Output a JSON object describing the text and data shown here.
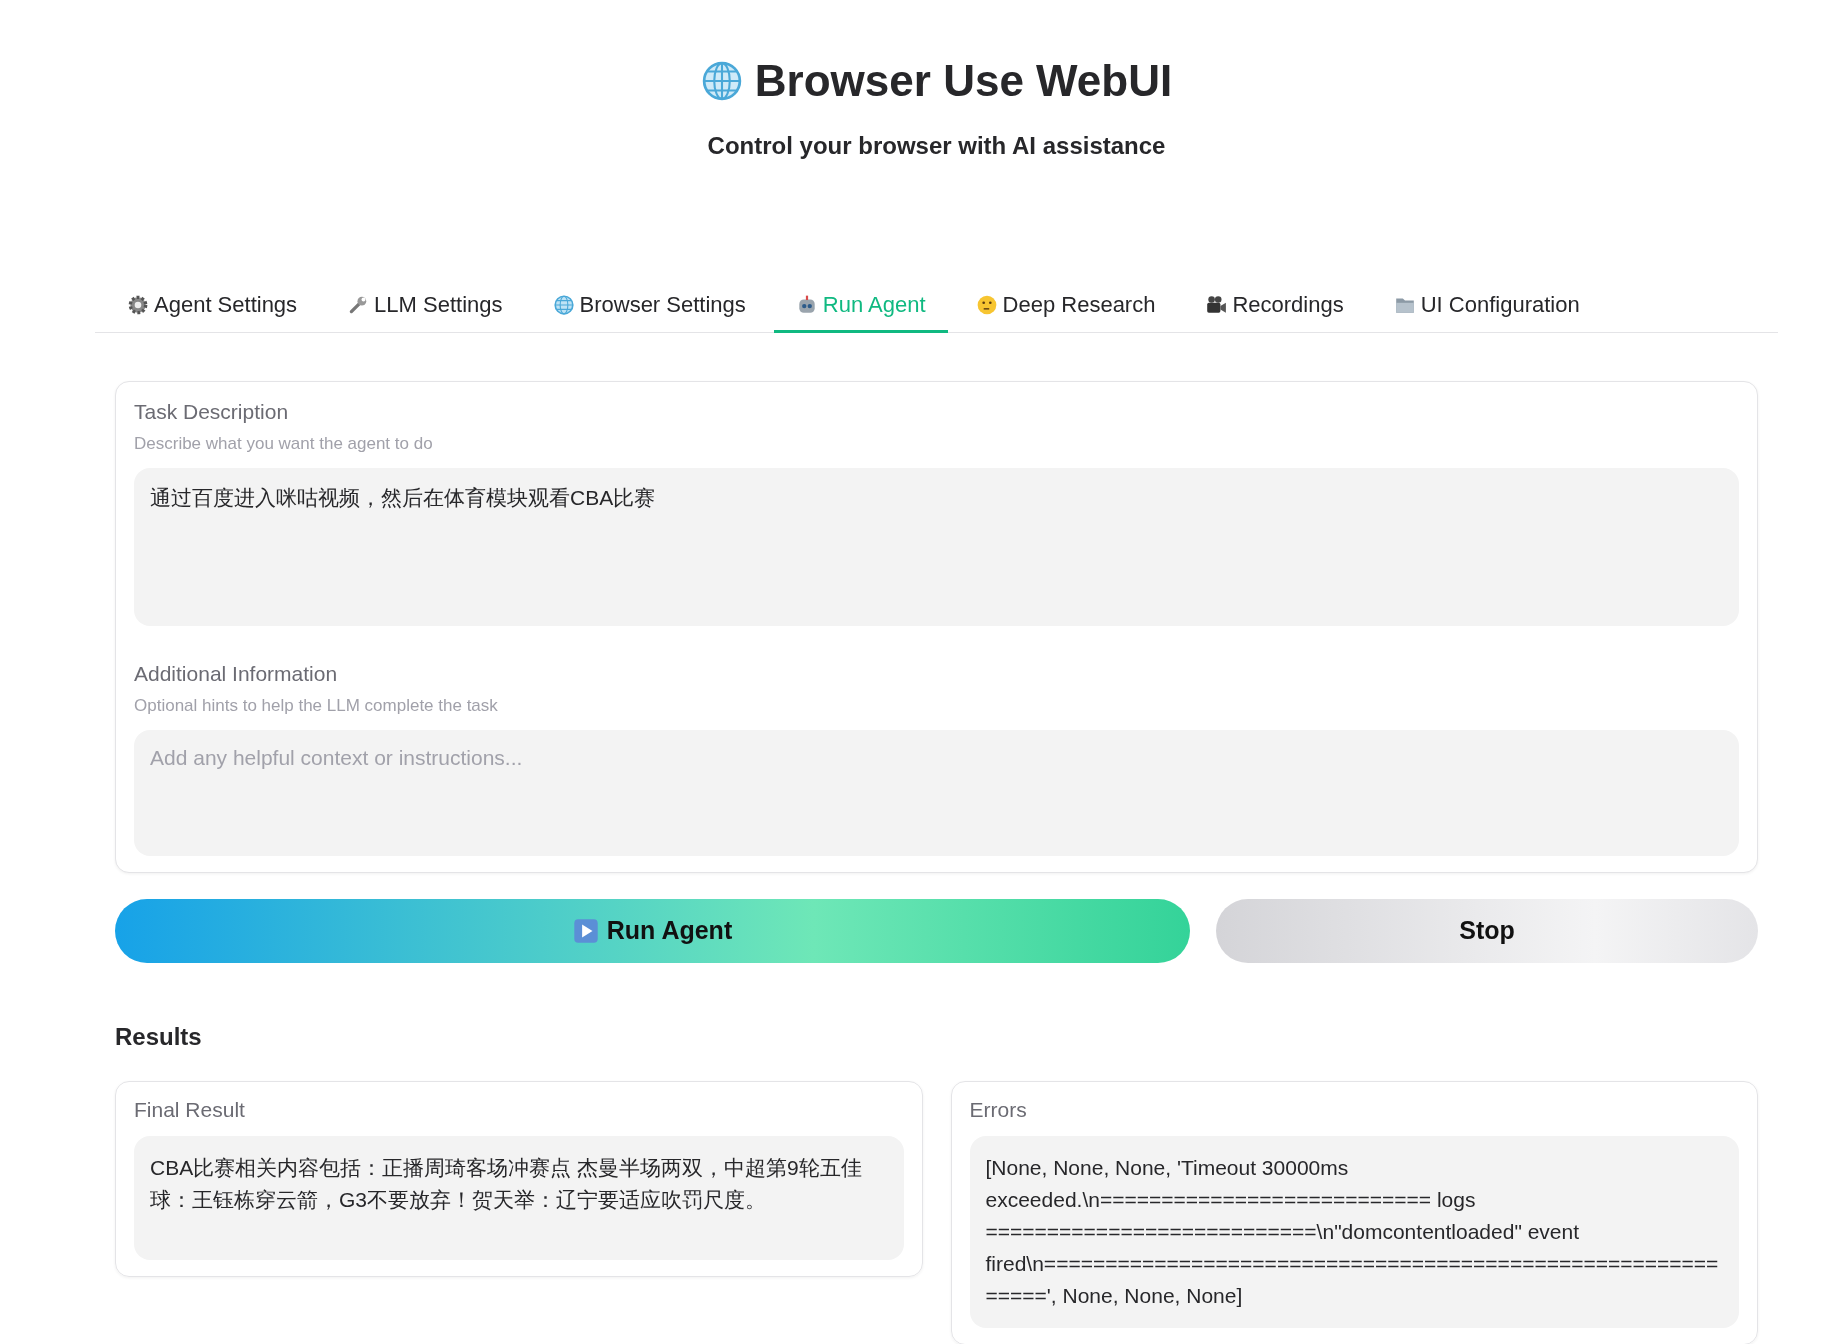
{
  "header": {
    "title": "Browser Use WebUI",
    "subtitle": "Control your browser with AI assistance"
  },
  "tabs": [
    {
      "label": "Agent Settings",
      "selected": false
    },
    {
      "label": "LLM Settings",
      "selected": false
    },
    {
      "label": "Browser Settings",
      "selected": false
    },
    {
      "label": "Run Agent",
      "selected": true
    },
    {
      "label": "Deep Research",
      "selected": false
    },
    {
      "label": "Recordings",
      "selected": false
    },
    {
      "label": "UI Configuration",
      "selected": false
    }
  ],
  "task_card": {
    "fields": [
      {
        "label": "Task Description",
        "info": "Describe what you want the agent to do",
        "value": "通过百度进入咪咕视频，然后在体育模块观看CBA比赛",
        "tall": true
      },
      {
        "label": "Additional Information",
        "info": "Optional hints to help the LLM complete the task",
        "placeholder": "Add any helpful context or instructions...",
        "tall": false
      }
    ]
  },
  "buttons": {
    "run": "Run Agent",
    "stop": "Stop"
  },
  "results": {
    "title": "Results",
    "panels": [
      {
        "label": "Final Result",
        "value": "CBA比赛相关内容包括：正播周琦客场冲赛点 杰曼半场两双，中超第9轮五佳球：王钰栋穿云箭，G3不要放弃！贺天举：辽宁要适应吹罚尺度。"
      },
      {
        "label": "Errors",
        "value": "[None, None, None, 'Timeout 30000ms exceeded.\\n=========================== logs ===========================\\n\"domcontentloaded\" event fired\\n============================================================', None, None, None]"
      }
    ]
  }
}
